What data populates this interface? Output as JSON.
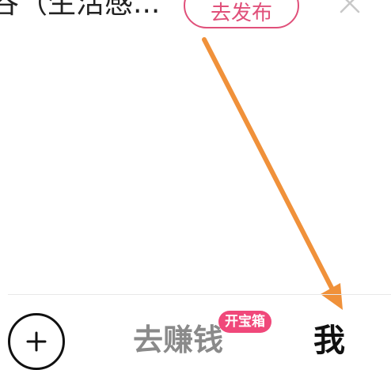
{
  "banner": {
    "text": "谷（生活感...",
    "publish_label": "去发布",
    "close_icon": "close-icon"
  },
  "tabbar": {
    "add_icon": "plus-circle-icon",
    "earn_label": "去赚钱",
    "earn_badge": "开宝箱",
    "me_label": "我"
  },
  "colors": {
    "accent_pink": "#e0507a",
    "badge_pink": "#f0487a",
    "arrow_orange": "#f0913a",
    "inactive_tab": "#8a8a8a",
    "active_tab": "#111111"
  }
}
